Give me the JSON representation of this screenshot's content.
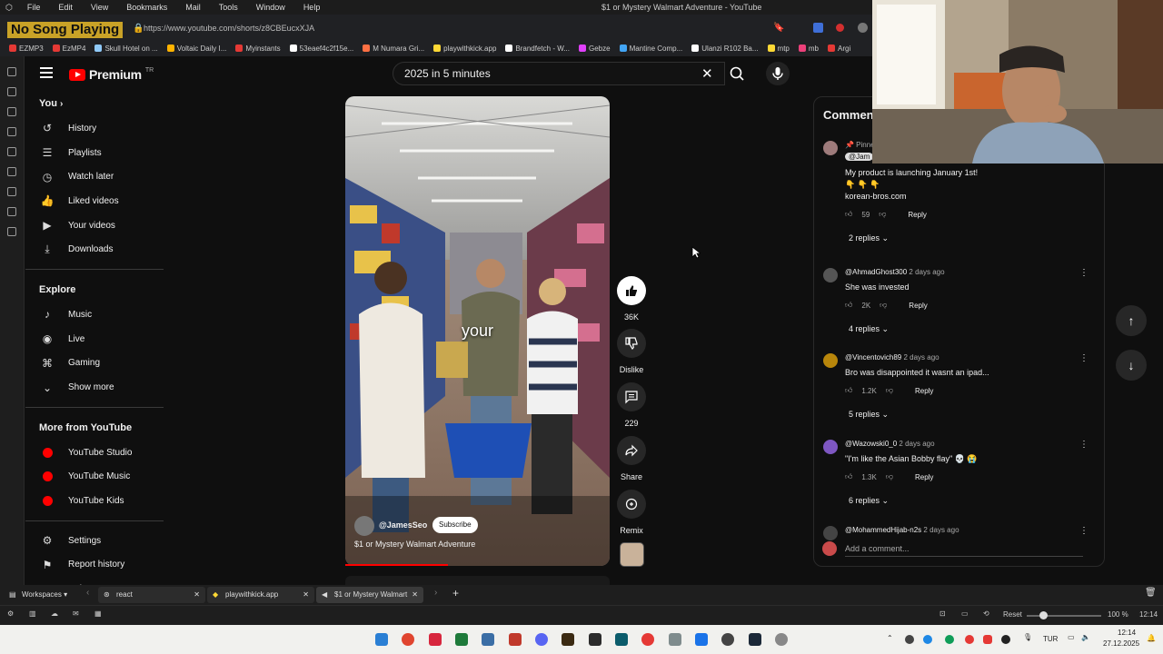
{
  "browser": {
    "menu": [
      "File",
      "Edit",
      "View",
      "Bookmarks",
      "Mail",
      "Tools",
      "Window",
      "Help"
    ],
    "window_title": "$1 or Mystery Walmart Adventure - YouTube",
    "now_playing": "No Song Playing",
    "url": "https://www.youtube.com/shorts/z8CBEucxXJA",
    "bookmarks": [
      {
        "label": "EZMP3",
        "color": "#e53935"
      },
      {
        "label": "EzMP4",
        "color": "#e53935"
      },
      {
        "label": "Skull Hotel on ...",
        "color": "#90caf9"
      },
      {
        "label": "Voltaic Daily I...",
        "color": "#ffb300"
      },
      {
        "label": "Myinstants",
        "color": "#e53935"
      },
      {
        "label": "53eaef4c2f15e...",
        "color": "#ffffff"
      },
      {
        "label": "M Numara Gri...",
        "color": "#ff7043"
      },
      {
        "label": "playwithkick.app",
        "color": "#fdd835"
      },
      {
        "label": "Brandfetch - W...",
        "color": "#ffffff"
      },
      {
        "label": "Gebze",
        "color": "#e040fb"
      },
      {
        "label": "Mantine Comp...",
        "color": "#42a5f5"
      },
      {
        "label": "Ulanzi R102 Ba...",
        "color": "#ffffff"
      },
      {
        "label": "mtp",
        "color": "#fdd835"
      },
      {
        "label": "mb",
        "color": "#ec407a"
      },
      {
        "label": "Argi",
        "color": "#e53935"
      }
    ]
  },
  "youtube": {
    "logo_text": "Premium",
    "logo_region": "TR",
    "search_value": "2025 in 5 minutes",
    "sidebar": {
      "you_label": "You",
      "you_items": [
        {
          "label": "History",
          "icon": "history-icon",
          "glyph": "↺"
        },
        {
          "label": "Playlists",
          "icon": "playlists-icon",
          "glyph": "☰"
        },
        {
          "label": "Watch later",
          "icon": "clock-icon",
          "glyph": "◷"
        },
        {
          "label": "Liked videos",
          "icon": "thumb-up-icon",
          "glyph": "👍"
        },
        {
          "label": "Your videos",
          "icon": "play-box-icon",
          "glyph": "▶"
        },
        {
          "label": "Downloads",
          "icon": "download-icon",
          "glyph": "⤓"
        }
      ],
      "explore_label": "Explore",
      "explore_items": [
        {
          "label": "Music",
          "icon": "music-note-icon",
          "glyph": "♪"
        },
        {
          "label": "Live",
          "icon": "live-icon",
          "glyph": "◉"
        },
        {
          "label": "Gaming",
          "icon": "gamepad-icon",
          "glyph": "⌘"
        },
        {
          "label": "Show more",
          "icon": "chevron-down-icon",
          "glyph": "⌄"
        }
      ],
      "more_label": "More from YouTube",
      "more_items": [
        {
          "label": "YouTube Studio",
          "icon": "youtube-studio-icon"
        },
        {
          "label": "YouTube Music",
          "icon": "youtube-music-icon"
        },
        {
          "label": "YouTube Kids",
          "icon": "youtube-kids-icon"
        }
      ],
      "settings_items": [
        {
          "label": "Settings",
          "icon": "gear-icon",
          "glyph": "⚙"
        },
        {
          "label": "Report history",
          "icon": "flag-icon",
          "glyph": "⚑"
        },
        {
          "label": "Help",
          "icon": "help-icon",
          "glyph": "?"
        }
      ]
    },
    "short": {
      "caption_word": "your",
      "channel": "@JamesSeo",
      "subscribe": "Subscribe",
      "title": "$1 or Mystery Walmart Adventure",
      "progress": 0.39,
      "likes": "36K",
      "dislike": "Dislike",
      "comments_count": "229",
      "share": "Share",
      "remix": "Remix"
    },
    "comments": {
      "header": "Comment",
      "items": [
        {
          "pinned": "Pinne",
          "author": "@Jam",
          "time": "",
          "text": "My product is launching January 1st!\n👇 👇 👇\nkorean-bros.com",
          "likes": "59",
          "reply": "Reply",
          "replies": "2 replies",
          "avatar": "#9e7b7b"
        },
        {
          "author": "@AhmadGhost300",
          "time": "2 days ago",
          "text": "She was invested",
          "likes": "2K",
          "reply": "Reply",
          "replies": "4 replies",
          "avatar": "#555555"
        },
        {
          "author": "@Vincentovich89",
          "time": "2 days ago",
          "text": "Bro was disappointed it wasnt an ipad...",
          "likes": "1.2K",
          "reply": "Reply",
          "replies": "5 replies",
          "avatar": "#b8860b"
        },
        {
          "author": "@Wazowski0_0",
          "time": "2 days ago",
          "text": "\"I'm like the Asian Bobby flay\" 💀 😭",
          "likes": "1.3K",
          "reply": "Reply",
          "replies": "6 replies",
          "avatar": "#7e57c2"
        },
        {
          "author": "@MohammedHijab-n2s",
          "time": "2 days ago",
          "text": "",
          "likes": "",
          "reply": "",
          "replies": "",
          "avatar": "#444444"
        }
      ],
      "add_placeholder": "Add a comment..."
    }
  },
  "tabs": {
    "workspaces": "Workspaces",
    "items": [
      "react",
      "playwithkick.app",
      "$1 or Mystery Walmart"
    ]
  },
  "status": {
    "reset": "Reset",
    "zoom": "100 %",
    "time": "12:14"
  },
  "taskbar": {
    "lang": "TUR",
    "time": "12:14",
    "date": "27.12.2025"
  }
}
